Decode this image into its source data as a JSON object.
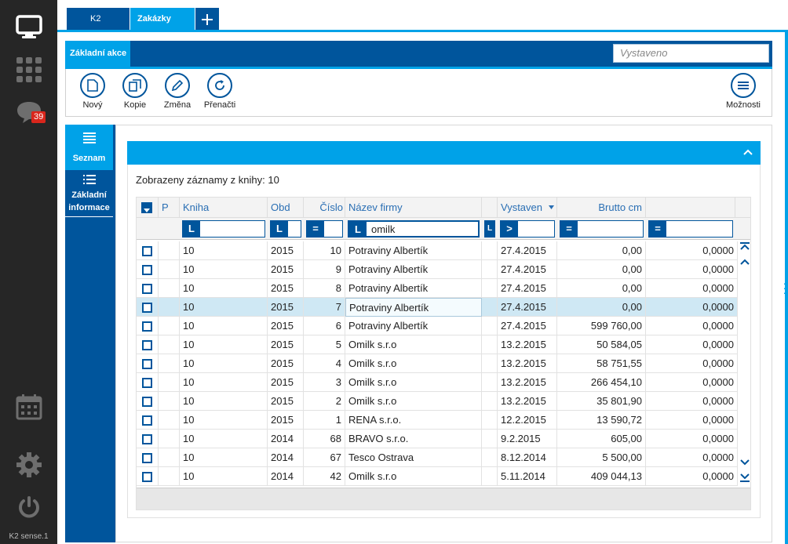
{
  "rail": {
    "badge_count": "39",
    "footer": "K2 sense.1"
  },
  "tabs": [
    {
      "label": "K2"
    },
    {
      "label": "Zakázky"
    }
  ],
  "actionbar": {
    "title": "Základní akce",
    "search_placeholder": "Vystaveno"
  },
  "toolbar": {
    "new": "Nový",
    "copy": "Kopie",
    "edit": "Změna",
    "reload": "Přenačti",
    "options": "Možnosti"
  },
  "sidenav": {
    "list": "Seznam",
    "info_line1": "Základní",
    "info_line2": "informace"
  },
  "list": {
    "count_text": "Zobrazeny záznamy z knihy: 10"
  },
  "grid": {
    "headers": {
      "p": "P",
      "kniha": "Kniha",
      "obd": "Obd",
      "cislo": "Číslo",
      "nazev": "Název firmy",
      "vystaveno": "Vystaven",
      "brutto": "Brutto cm"
    },
    "filters": {
      "kniha_op": "L",
      "obd_op": "L",
      "cislo_op": "=",
      "nazev_op": "L",
      "nazev_value": "omilk",
      "vyst_op": ">",
      "brutto_op": "=",
      "last_op": "="
    },
    "rows": [
      {
        "kniha": "10",
        "obd": "2015",
        "cislo": "10",
        "nazev": "Potraviny Albertík",
        "vystaveno": "27.4.2015",
        "brutto": "0,00",
        "last": "0,0000"
      },
      {
        "kniha": "10",
        "obd": "2015",
        "cislo": "9",
        "nazev": "Potraviny Albertík",
        "vystaveno": "27.4.2015",
        "brutto": "0,00",
        "last": "0,0000"
      },
      {
        "kniha": "10",
        "obd": "2015",
        "cislo": "8",
        "nazev": "Potraviny Albertík",
        "vystaveno": "27.4.2015",
        "brutto": "0,00",
        "last": "0,0000"
      },
      {
        "kniha": "10",
        "obd": "2015",
        "cislo": "7",
        "nazev": "Potraviny Albertík",
        "vystaveno": "27.4.2015",
        "brutto": "0,00",
        "last": "0,0000"
      },
      {
        "kniha": "10",
        "obd": "2015",
        "cislo": "6",
        "nazev": "Potraviny Albertík",
        "vystaveno": "27.4.2015",
        "brutto": "599 760,00",
        "last": "0,0000"
      },
      {
        "kniha": "10",
        "obd": "2015",
        "cislo": "5",
        "nazev": "Omilk s.r.o",
        "vystaveno": "13.2.2015",
        "brutto": "50 584,05",
        "last": "0,0000"
      },
      {
        "kniha": "10",
        "obd": "2015",
        "cislo": "4",
        "nazev": "Omilk s.r.o",
        "vystaveno": "13.2.2015",
        "brutto": "58 751,55",
        "last": "0,0000"
      },
      {
        "kniha": "10",
        "obd": "2015",
        "cislo": "3",
        "nazev": "Omilk s.r.o",
        "vystaveno": "13.2.2015",
        "brutto": "266 454,10",
        "last": "0,0000"
      },
      {
        "kniha": "10",
        "obd": "2015",
        "cislo": "2",
        "nazev": "Omilk s.r.o",
        "vystaveno": "13.2.2015",
        "brutto": "35 801,90",
        "last": "0,0000"
      },
      {
        "kniha": "10",
        "obd": "2015",
        "cislo": "1",
        "nazev": "RENA s.r.o.",
        "vystaveno": "12.2.2015",
        "brutto": "13 590,72",
        "last": "0,0000"
      },
      {
        "kniha": "10",
        "obd": "2014",
        "cislo": "68",
        "nazev": "BRAVO s.r.o.",
        "vystaveno": "9.2.2015",
        "brutto": "605,00",
        "last": "0,0000"
      },
      {
        "kniha": "10",
        "obd": "2014",
        "cislo": "67",
        "nazev": "Tesco Ostrava",
        "vystaveno": "8.12.2014",
        "brutto": "5 500,00",
        "last": "0,0000"
      },
      {
        "kniha": "10",
        "obd": "2014",
        "cislo": "42",
        "nazev": "Omilk s.r.o",
        "vystaveno": "5.11.2014",
        "brutto": "409 044,13",
        "last": "0,0000"
      }
    ],
    "selected_row": 3
  },
  "colors": {
    "dark_blue": "#00559c",
    "light_blue": "#00a2e8",
    "rail": "#262626",
    "badge": "#d9261c"
  }
}
